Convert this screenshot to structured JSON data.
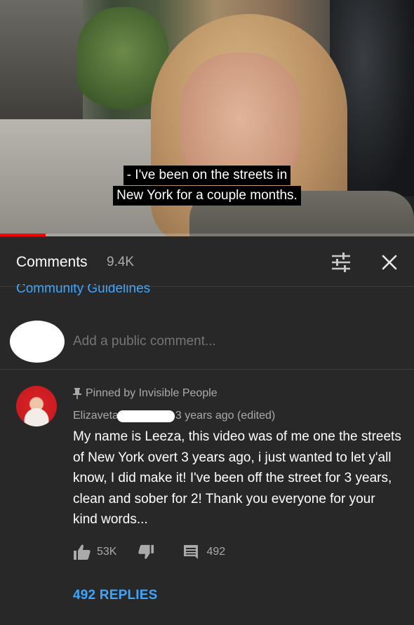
{
  "video": {
    "caption_line1": "- I've been on the streets in",
    "caption_line2": "New York for a couple months.",
    "progress_fraction": 0.11,
    "progress_color": "#ff0000"
  },
  "comments_header": {
    "title": "Comments",
    "count": "9.4K",
    "sort_icon": "sliders-icon",
    "close_icon": "close-icon"
  },
  "guidelines": {
    "label": "Community Guidelines"
  },
  "add_comment": {
    "placeholder": "Add a public comment..."
  },
  "comment": {
    "pinned_label": "Pinned by Invisible People",
    "author": "Elizaveta",
    "timestamp": "3 years ago (edited)",
    "text": "My name is Leeza, this video was of me one the streets of New York overt 3 years ago,  i just wanted to let y'all know,  I did make it!  I've been off the street for 3 years, clean and sober for 2! Thank you everyone for your kind words...",
    "likes": "53K",
    "reply_count": "492",
    "replies_label": "492 REPLIES"
  },
  "colors": {
    "background": "#282828",
    "link": "#3ea6ff",
    "muted_text": "#aaaaaa"
  }
}
